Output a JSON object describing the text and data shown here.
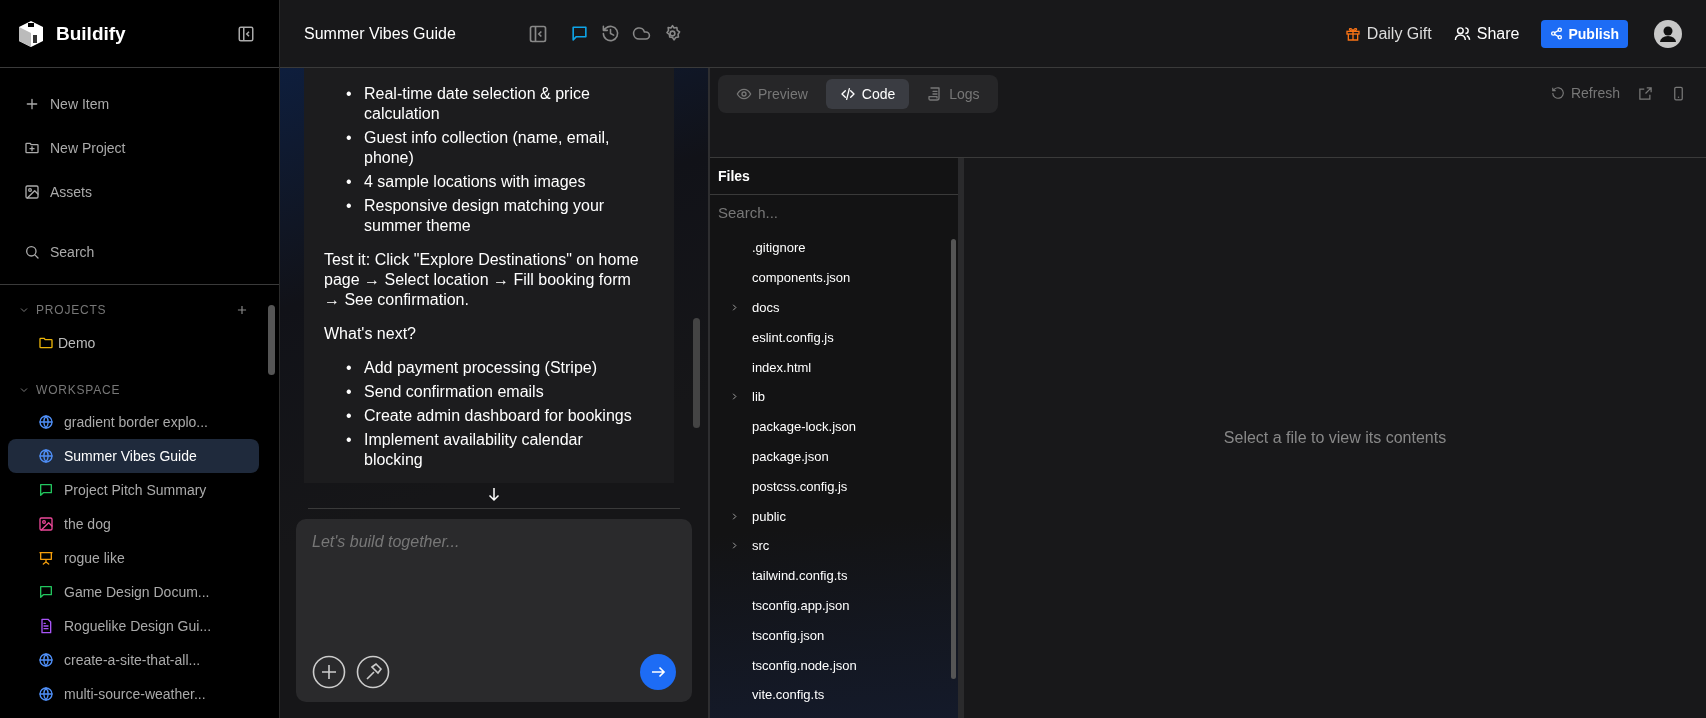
{
  "brand": {
    "name": "Buildify"
  },
  "nav": [
    {
      "kind": "plus",
      "label": "New Item"
    },
    {
      "kind": "folder-plus",
      "label": "New Project"
    },
    {
      "kind": "image",
      "label": "Assets"
    },
    {
      "kind": "search",
      "label": "Search"
    }
  ],
  "projects": {
    "title": "PROJECTS",
    "expanded": true,
    "items": [
      {
        "label": "Demo"
      }
    ]
  },
  "workspace": {
    "title": "WORKSPACE",
    "expanded": true,
    "items": [
      {
        "kind": "globe",
        "label": "gradient border explo...",
        "selected": false
      },
      {
        "kind": "globe",
        "label": "Summer Vibes Guide",
        "selected": true
      },
      {
        "kind": "chat",
        "label": "Project Pitch Summary",
        "selected": false
      },
      {
        "kind": "image",
        "label": "the dog",
        "selected": false
      },
      {
        "kind": "slides",
        "label": "rogue like",
        "selected": false
      },
      {
        "kind": "chat",
        "label": "Game Design Docum...",
        "selected": false
      },
      {
        "kind": "doc",
        "label": "Roguelike Design Gui...",
        "selected": false
      },
      {
        "kind": "globe",
        "label": "create-a-site-that-all...",
        "selected": false
      },
      {
        "kind": "globe",
        "label": "multi-source-weather...",
        "selected": false
      }
    ]
  },
  "header": {
    "title": "Summer Vibes Guide",
    "tools": [
      {
        "kind": "chat",
        "selected": true
      },
      {
        "kind": "history",
        "selected": false
      },
      {
        "kind": "cloud",
        "selected": false
      },
      {
        "kind": "settings",
        "selected": false
      }
    ],
    "daily_gift": "Daily Gift",
    "share": "Share",
    "publish": "Publish"
  },
  "message": {
    "blocks": [
      {
        "kind": "list",
        "bullet": "•",
        "items": [
          "Real-time date selection & price calculation",
          "Guest info collection (name, email, phone)",
          "4 sample locations with images",
          "Responsive design matching your summer theme"
        ]
      },
      {
        "kind": "para",
        "text": "Test it: Click \"Explore Destinations\" on home page → Select location → Fill booking form → See confirmation."
      },
      {
        "kind": "para",
        "text": "What's next?"
      },
      {
        "kind": "list",
        "bullet": "•",
        "items": [
          "Add payment processing (Stripe)",
          "Send confirmation emails",
          "Create admin dashboard for bookings",
          "Implement availability calendar blocking"
        ]
      }
    ]
  },
  "composer": {
    "placeholder": "Let's build together..."
  },
  "view_tabs": [
    {
      "kind": "eye",
      "label": "Preview",
      "selected": false
    },
    {
      "kind": "code",
      "label": "Code",
      "selected": true
    },
    {
      "kind": "logs",
      "label": "Logs",
      "selected": false
    }
  ],
  "refresh": "Refresh",
  "files": {
    "title": "Files",
    "placeholder": "Search...",
    "items": [
      {
        "kind": "file",
        "name": ".gitignore"
      },
      {
        "kind": "file",
        "name": "components.json"
      },
      {
        "kind": "folder",
        "name": "docs"
      },
      {
        "kind": "file",
        "name": "eslint.config.js"
      },
      {
        "kind": "file",
        "name": "index.html"
      },
      {
        "kind": "folder",
        "name": "lib"
      },
      {
        "kind": "file",
        "name": "package-lock.json"
      },
      {
        "kind": "file",
        "name": "package.json"
      },
      {
        "kind": "file",
        "name": "postcss.config.js"
      },
      {
        "kind": "folder",
        "name": "public"
      },
      {
        "kind": "folder",
        "name": "src"
      },
      {
        "kind": "file",
        "name": "tailwind.config.ts"
      },
      {
        "kind": "file",
        "name": "tsconfig.app.json"
      },
      {
        "kind": "file",
        "name": "tsconfig.json"
      },
      {
        "kind": "file",
        "name": "tsconfig.node.json"
      },
      {
        "kind": "file",
        "name": "vite.config.ts"
      }
    ]
  },
  "empty_state": "Select a file to view its contents"
}
